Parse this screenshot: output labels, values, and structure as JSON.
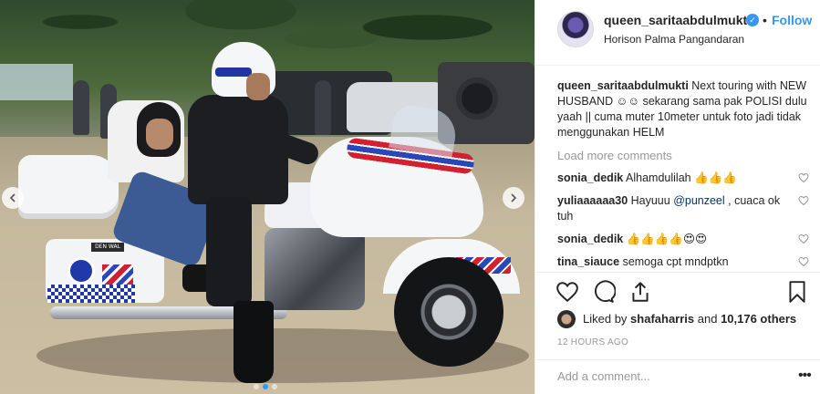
{
  "post": {
    "username": "queen_saritaabdulmukti",
    "verified_icon": "verified-badge-icon",
    "separator": "•",
    "follow_label": "Follow",
    "location": "Horison Palma Pangandaran",
    "caption_user": "queen_saritaabdulmukti",
    "caption_text": " Next touring with NEW HUSBAND ☺☺ sekarang sama pak POLISI dulu yaah || cuma muter 10meter untuk foto jadi tidak menggunakan HELM",
    "load_more": "Load more comments",
    "comments": [
      {
        "user": "sonia_dedik",
        "text": " Alhamdulilah 👍👍👍",
        "mention": "",
        "after": ""
      },
      {
        "user": "yuliaaaaaa30",
        "text": " Hayuuu ",
        "mention": "@punzeel",
        "after": " , cuaca ok tuh"
      },
      {
        "user": "sonia_dedik",
        "text": " 👍👍👍👍😍😍",
        "mention": "",
        "after": ""
      },
      {
        "user": "tina_siauce",
        "text": " semoga cpt mndptkn",
        "mention": "",
        "after": ""
      }
    ],
    "likes_prefix": "Liked by ",
    "likes_user": "shafaharris",
    "likes_and": " and ",
    "likes_count": "10,176 others",
    "timestamp": "12 HOURS AGO",
    "add_comment_placeholder": "Add a comment...",
    "more_options": "•••",
    "plate_text": "DEN WAL"
  },
  "carousel": {
    "total": 3,
    "active_index": 1
  },
  "colors": {
    "accent": "#3897f0",
    "muted": "#999999",
    "text": "#262626"
  }
}
